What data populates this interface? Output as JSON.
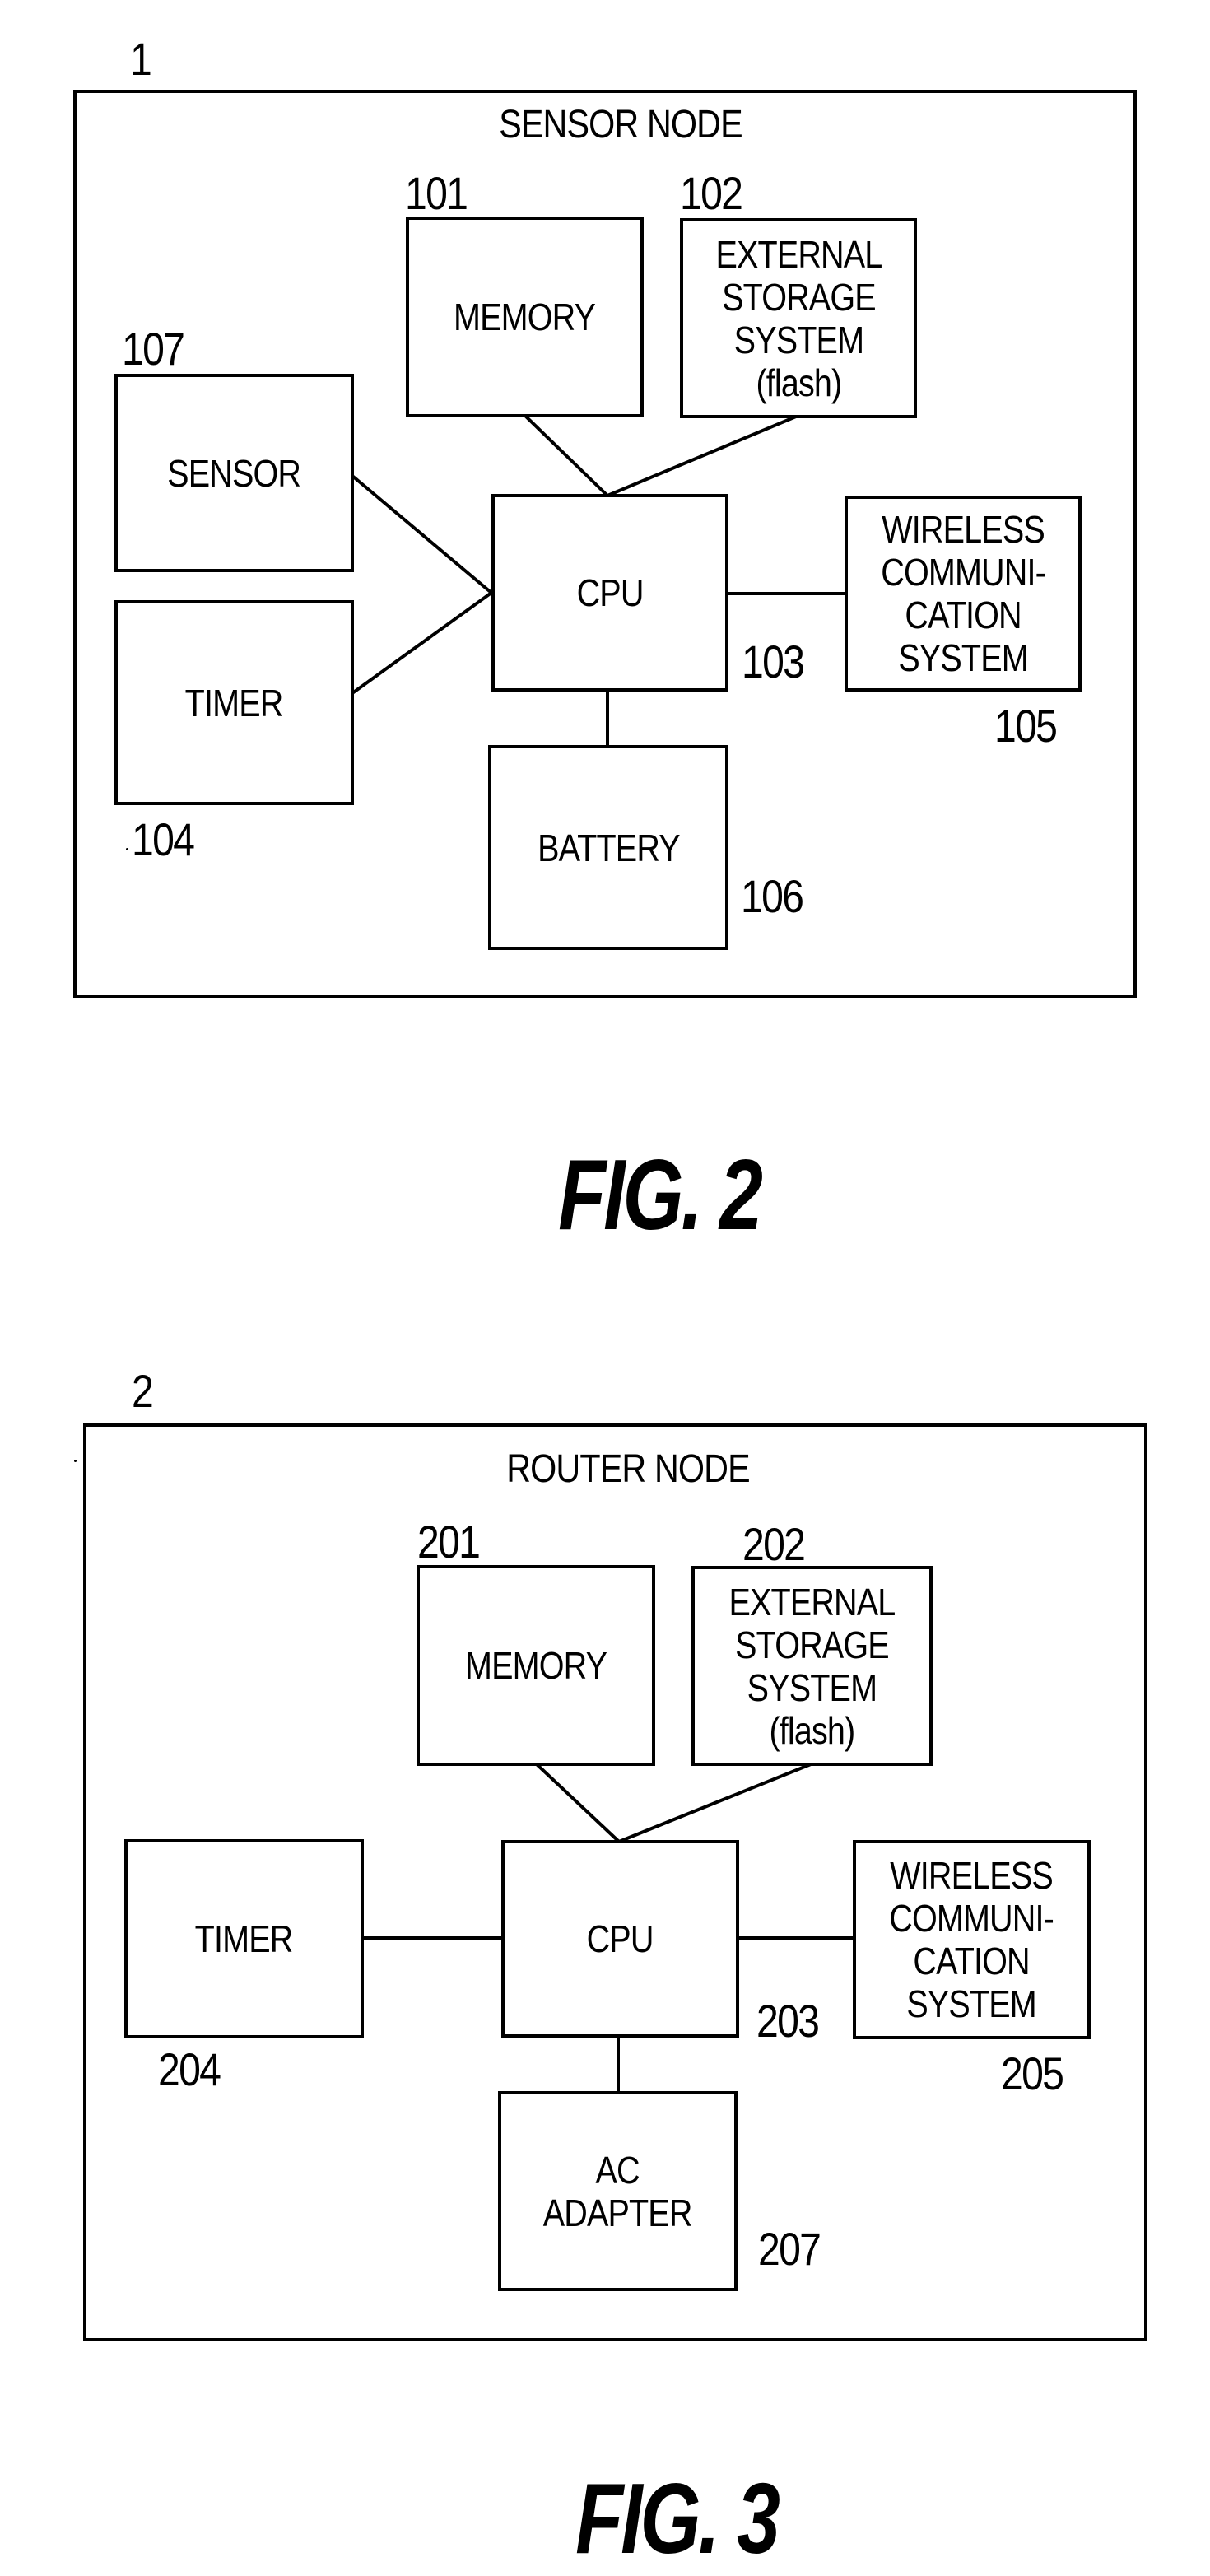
{
  "figures": [
    {
      "id": "fig2",
      "node_ref": "1",
      "node_title": "SENSOR NODE",
      "caption": "FIG. 2",
      "blocks": {
        "memory": {
          "ref": "101",
          "label": "MEMORY"
        },
        "external_storage": {
          "ref": "102",
          "label": "EXTERNAL\nSTORAGE\nSYSTEM\n(flash)"
        },
        "cpu": {
          "ref": "103",
          "label": "CPU"
        },
        "timer": {
          "ref": "104",
          "label": "TIMER"
        },
        "wireless": {
          "ref": "105",
          "label": "WIRELESS\nCOMMUNI-\nCATION\nSYSTEM"
        },
        "power": {
          "ref": "106",
          "label": "BATTERY"
        },
        "sensor": {
          "ref": "107",
          "label": "SENSOR"
        }
      },
      "connections": [
        [
          "memory",
          "cpu"
        ],
        [
          "external_storage",
          "cpu"
        ],
        [
          "sensor",
          "cpu"
        ],
        [
          "timer",
          "cpu"
        ],
        [
          "cpu",
          "wireless"
        ],
        [
          "cpu",
          "power"
        ]
      ]
    },
    {
      "id": "fig3",
      "node_ref": "2",
      "node_title": "ROUTER NODE",
      "caption": "FIG. 3",
      "blocks": {
        "memory": {
          "ref": "201",
          "label": "MEMORY"
        },
        "external_storage": {
          "ref": "202",
          "label": "EXTERNAL\nSTORAGE\nSYSTEM\n(flash)"
        },
        "cpu": {
          "ref": "203",
          "label": "CPU"
        },
        "timer": {
          "ref": "204",
          "label": "TIMER"
        },
        "wireless": {
          "ref": "205",
          "label": "WIRELESS\nCOMMUNI-\nCATION\nSYSTEM"
        },
        "power": {
          "ref": "207",
          "label": "AC\nADAPTER"
        }
      },
      "connections": [
        [
          "memory",
          "cpu"
        ],
        [
          "external_storage",
          "cpu"
        ],
        [
          "timer",
          "cpu"
        ],
        [
          "cpu",
          "wireless"
        ],
        [
          "cpu",
          "power"
        ]
      ]
    }
  ]
}
